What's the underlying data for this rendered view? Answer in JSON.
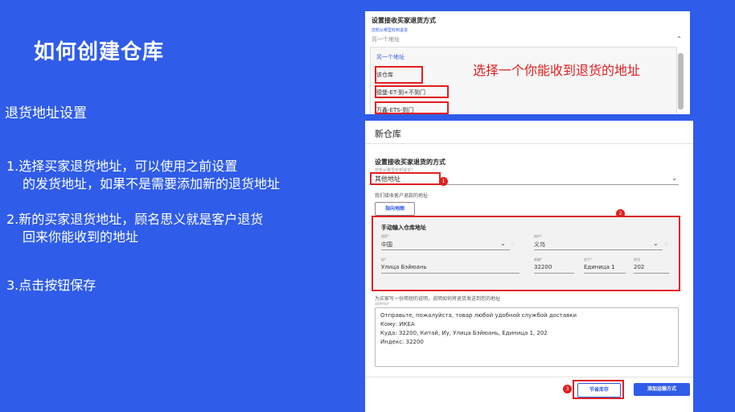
{
  "slide": {
    "title": "如何创建仓库",
    "section": "退货地址设置",
    "steps": [
      {
        "line1": "1.选择买家退货地址，可以使用之前设置",
        "line2": "的发货地址，如果不是需要添加新的退货地址"
      },
      {
        "line1": "2.新的买家退货地址，顾名思义就是客户退货",
        "line2": "回来你能收到的地址"
      },
      {
        "line1": "3.点击按钮保存",
        "line2": ""
      }
    ]
  },
  "screenshot_top": {
    "header": "设置接收买家退货方式",
    "sub": "您想从哪里收到退货",
    "selected": "另一个地址",
    "options": [
      "另一个地址",
      "该仓库",
      "德堡-ET-到+不到门",
      "万鑫-ETS-到门"
    ],
    "callout": "选择一个你能收到退货的地址"
  },
  "screenshot_bottom": {
    "title": "新仓库",
    "section_header": "设置接收买家退货的方式",
    "select_small_label": "您想从哪里收到退货?",
    "select_value": "其他地址",
    "note": "我们接收客户退款的地址",
    "map_button": "指向地图",
    "panel_title": "手动输入仓库地址",
    "country_label": "国家*",
    "country_value": "中国",
    "city_label": "城市*",
    "city_value": "义乌",
    "street_label": "街*",
    "street_value": "Улица Бэйюань",
    "zip_label": "邮编*",
    "zip_value": "32200",
    "building_label": "房子*",
    "building_value": "Единица 1",
    "room_label": "房间",
    "room_value": "202",
    "instructions_label": "为买家写一份简短的说明，说明如何将退货发送到您的地址",
    "instructions_small": "说明代码*",
    "instructions_text": [
      "Отправьте, пожалуйста, товар любой удобной службой доставки",
      "Кому: ИКЕА",
      "Куда: 32200, Китай, Иу, Улица Бэйюань, Единица 1, 202",
      "Индекс: 32200"
    ],
    "save_button": "节省库存",
    "add_shipping_button": "添加运输方式",
    "badges": [
      "1",
      "2",
      "3"
    ]
  },
  "colors": {
    "background": "#2f5ce8",
    "accent": "#2f5ce8",
    "highlight": "#e02020"
  }
}
